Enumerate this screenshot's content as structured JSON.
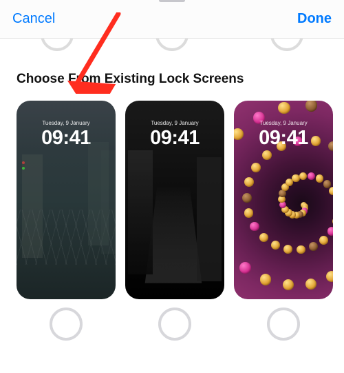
{
  "nav": {
    "cancel_label": "Cancel",
    "done_label": "Done"
  },
  "section": {
    "heading": "Choose From Existing Lock Screens"
  },
  "screens": [
    {
      "date": "Tuesday, 9 January",
      "time": "09:41",
      "style": "city"
    },
    {
      "date": "Tuesday, 9 January",
      "time": "09:41",
      "style": "dark"
    },
    {
      "date": "Tuesday, 9 January",
      "time": "09:41",
      "style": "emoji"
    }
  ],
  "annotation": {
    "arrow_color": "#ff2d1f"
  }
}
